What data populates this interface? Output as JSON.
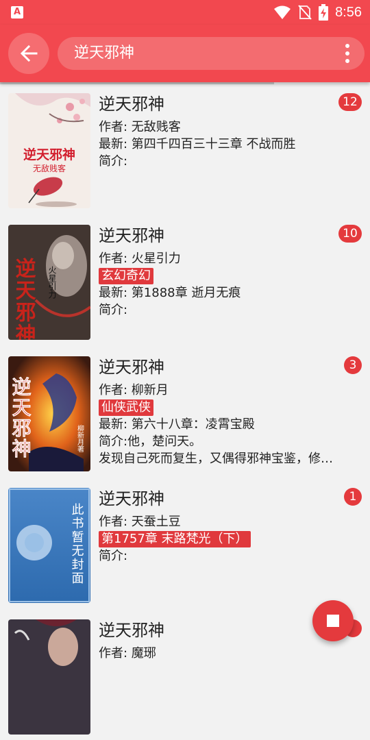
{
  "status_bar": {
    "time": "8:56",
    "app_icon": "A"
  },
  "toolbar": {
    "search_query": "逆天邪神"
  },
  "colors": {
    "primary": "#f2484f",
    "badge": "#e43a3d",
    "tag": "#e0393d"
  },
  "books": [
    {
      "title": "逆天邪神",
      "author": "作者: 无敌贱客",
      "tag": "",
      "latest": "最新: 第四千四百三十三章 不战而胜",
      "intro": "简介:",
      "intro_extra": "",
      "badge": "12",
      "cover_title": "逆天邪神",
      "cover_subtitle": "无敌贱客"
    },
    {
      "title": "逆天邪神",
      "author": "作者: 火星引力",
      "tag": "玄幻奇幻",
      "latest": "最新: 第1888章 逝月无痕",
      "intro": "简介:",
      "intro_extra": "",
      "badge": "10",
      "cover_title": "逆天邪神",
      "cover_subtitle": "火星引力"
    },
    {
      "title": "逆天邪神",
      "author": "作者: 柳新月",
      "tag": "仙侠武侠",
      "latest": "最新: 第六十八章：凌霄宝殿",
      "intro": "简介:他，楚问天。",
      "intro_extra": "发现自己死而复生，又偶得邪神宝鉴，修…",
      "badge": "3",
      "cover_title": "逆天邪神",
      "cover_subtitle": "柳新月著"
    },
    {
      "title": "逆天邪神",
      "author": "作者: 天蚕土豆",
      "tag": "第1757章 末路梵光（下）",
      "latest": "",
      "intro": "简介:",
      "intro_extra": "",
      "badge": "1",
      "cover_title": "此书暂无封面",
      "cover_subtitle": ""
    },
    {
      "title": "逆天邪神",
      "author": "作者: 魔琊",
      "tag": "",
      "latest": "",
      "intro": "",
      "intro_extra": "",
      "badge": "",
      "cover_title": "",
      "cover_subtitle": ""
    }
  ]
}
